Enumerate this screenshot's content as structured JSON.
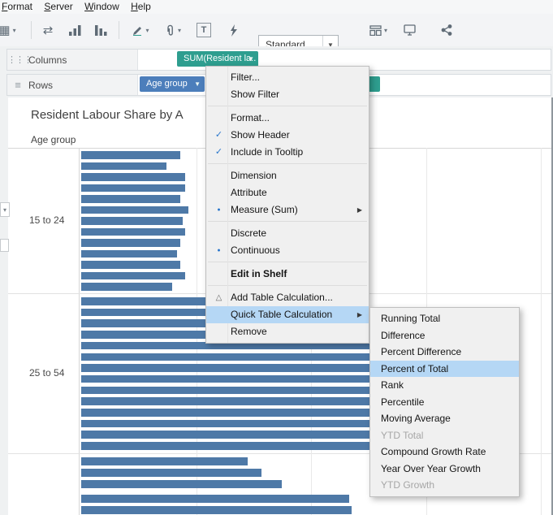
{
  "menu_bar": {
    "items": [
      "Format",
      "Server",
      "Window",
      "Help"
    ]
  },
  "toolbar": {
    "fit_selector_value": "Standard",
    "icon_names": [
      "new-worksheet-icon",
      "swap-rows-columns-icon",
      "sort-ascending-icon",
      "sort-descending-icon",
      "highlight-icon",
      "group-members-icon",
      "show-mark-labels-icon",
      "fix-axes-icon",
      "show-hide-cards-icon",
      "presentation-mode-icon",
      "share-workbook-icon"
    ]
  },
  "shelves": {
    "columns": {
      "label": "Columns",
      "pill": "SUM(Resident la.."
    },
    "rows": {
      "label": "Rows",
      "pill_1": "Age group",
      "pill_2": ""
    }
  },
  "sheet": {
    "title": "Resident Labour Share by A",
    "column_header": "Age group"
  },
  "context_menu": {
    "items": [
      {
        "label": "Filter..."
      },
      {
        "label": "Show Filter"
      },
      {
        "label": "Format..."
      },
      {
        "label": "Show Header",
        "checked": true
      },
      {
        "label": "Include in Tooltip",
        "checked": true
      },
      {
        "label": "Dimension"
      },
      {
        "label": "Attribute"
      },
      {
        "label": "Measure (Sum)",
        "selected": true,
        "has_submenu": true
      },
      {
        "label": "Discrete"
      },
      {
        "label": "Continuous",
        "selected": true
      },
      {
        "label": "Edit in Shelf",
        "bold": true
      },
      {
        "label": "Add Table Calculation..."
      },
      {
        "label": "Quick Table Calculation",
        "highlighted": true,
        "has_submenu": true
      },
      {
        "label": "Remove"
      }
    ]
  },
  "submenu": {
    "items": [
      {
        "label": "Running Total"
      },
      {
        "label": "Difference"
      },
      {
        "label": "Percent Difference"
      },
      {
        "label": "Percent of Total",
        "highlighted": true
      },
      {
        "label": "Rank"
      },
      {
        "label": "Percentile"
      },
      {
        "label": "Moving Average"
      },
      {
        "label": "YTD Total",
        "disabled": true
      },
      {
        "label": "Compound Growth Rate"
      },
      {
        "label": "Year Over Year Growth"
      },
      {
        "label": "YTD Growth",
        "disabled": true
      }
    ]
  },
  "colors": {
    "pill_green": "#2E9E8F",
    "pill_blue": "#4C7EBB",
    "menu_highlight": "#B5D7F5",
    "bar_blue": "#4E79A7"
  },
  "chart_data": {
    "type": "bar",
    "orientation": "horizontal",
    "title": "Resident Labour Share by A",
    "row_field": "Age group",
    "bar_color": "#4E79A7",
    "axis": {
      "min": 0,
      "max": 100,
      "gridline_pct": [
        25,
        50,
        75,
        100
      ]
    },
    "groups": [
      {
        "label": "15 to 24",
        "values_pct": [
          21.6,
          18.6,
          22.6,
          22.6,
          21.6,
          23.3,
          22.1,
          22.6,
          21.6,
          20.8,
          21.6,
          22.6,
          19.8
        ]
      },
      {
        "label": "25 to 54",
        "values_pct": [
          62.2,
          65.0,
          65.7,
          66.3,
          65.4,
          64.5,
          65.7,
          65.0,
          64.7,
          65.4,
          66.1,
          65.2,
          64.1,
          63.3
        ]
      },
      {
        "label": "",
        "values_pct": [
          36.2,
          39.2,
          43.6
        ]
      },
      {
        "label": "",
        "values_pct": [
          58.3,
          58.8
        ]
      }
    ]
  }
}
